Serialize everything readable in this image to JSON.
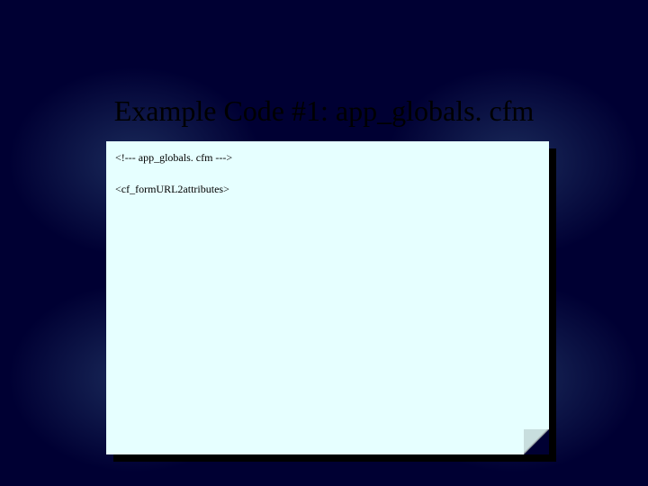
{
  "slide": {
    "title": "Example Code #1: app_globals. cfm",
    "code_lines": [
      "<!--- app_globals. cfm --->",
      "<cf_formURL2attributes>"
    ]
  }
}
